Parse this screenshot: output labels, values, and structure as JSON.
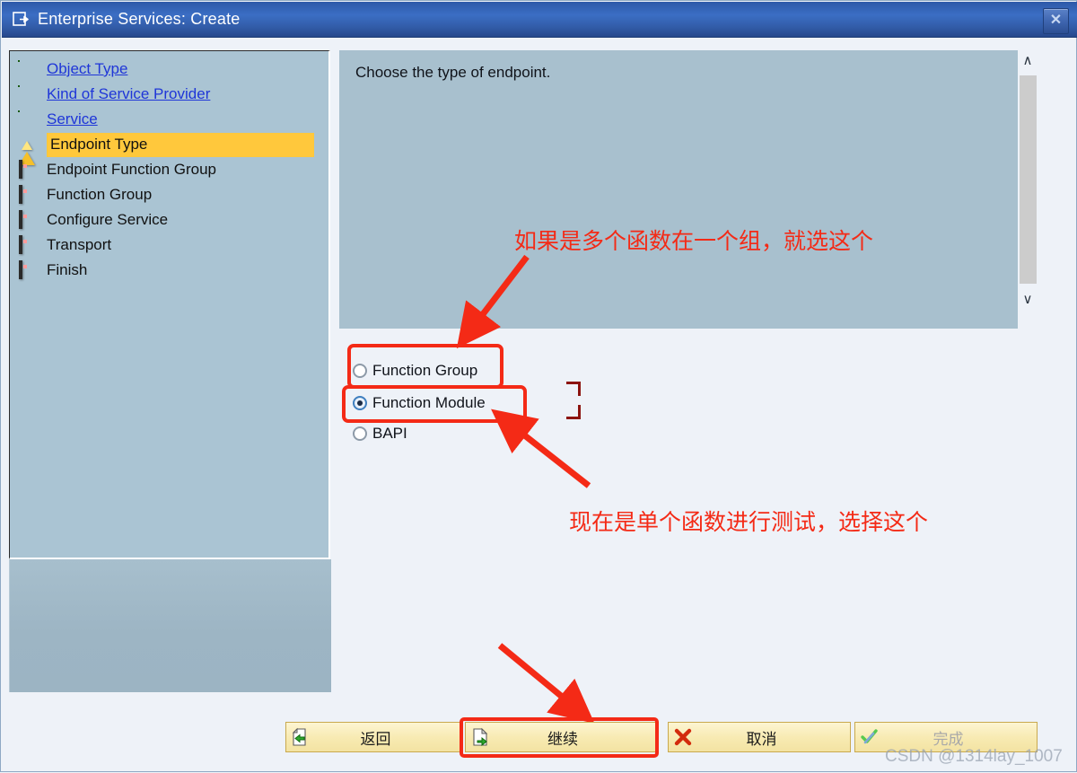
{
  "window": {
    "title": "Enterprise Services: Create",
    "title_icon": "create-document-icon",
    "close_label": "✕",
    "accent_title_bar": "#325ca8"
  },
  "sidebar": {
    "items": [
      {
        "label": "Object Type",
        "state": "done",
        "icon": "green-sphere-icon"
      },
      {
        "label": "Kind of Service Provider",
        "state": "done",
        "icon": "green-sphere-icon"
      },
      {
        "label": "Service",
        "state": "done",
        "icon": "green-sphere-icon"
      },
      {
        "label": "Endpoint Type",
        "state": "current",
        "icon": "warning-triangle-icon"
      },
      {
        "label": "Endpoint Function Group",
        "state": "pending",
        "icon": "red-square-icon"
      },
      {
        "label": "Function Group",
        "state": "pending",
        "icon": "red-square-icon"
      },
      {
        "label": "Configure Service",
        "state": "pending",
        "icon": "red-square-icon"
      },
      {
        "label": "Transport",
        "state": "pending",
        "icon": "red-square-icon"
      },
      {
        "label": "Finish",
        "state": "pending",
        "icon": "red-square-icon"
      }
    ],
    "highlight_color": "#ffc83c",
    "link_color": "#1f36d8"
  },
  "main": {
    "description": "Choose the type of endpoint.",
    "options": [
      {
        "label": "Function Group",
        "selected": false
      },
      {
        "label": "Function Module",
        "selected": true
      },
      {
        "label": "BAPI",
        "selected": false
      }
    ],
    "scrollbar": {
      "up_arrow": "∧",
      "down_arrow": "∨"
    }
  },
  "annotations": {
    "color": "#f42a16",
    "note_top": "如果是多个函数在一个组，就选这个",
    "note_bottom": "现在是单个函数进行测试，选择这个"
  },
  "buttons": [
    {
      "label": "返回",
      "icon": "page-back-arrow-icon",
      "disabled": false,
      "highlighted": false
    },
    {
      "label": "继续",
      "icon": "page-forward-arrow-icon",
      "disabled": false,
      "highlighted": true
    },
    {
      "label": "取消",
      "icon": "red-x-icon",
      "disabled": false,
      "highlighted": false
    },
    {
      "label": "完成",
      "icon": "green-check-icon",
      "disabled": true,
      "highlighted": false
    }
  ],
  "watermark": "CSDN @1314lay_1007"
}
